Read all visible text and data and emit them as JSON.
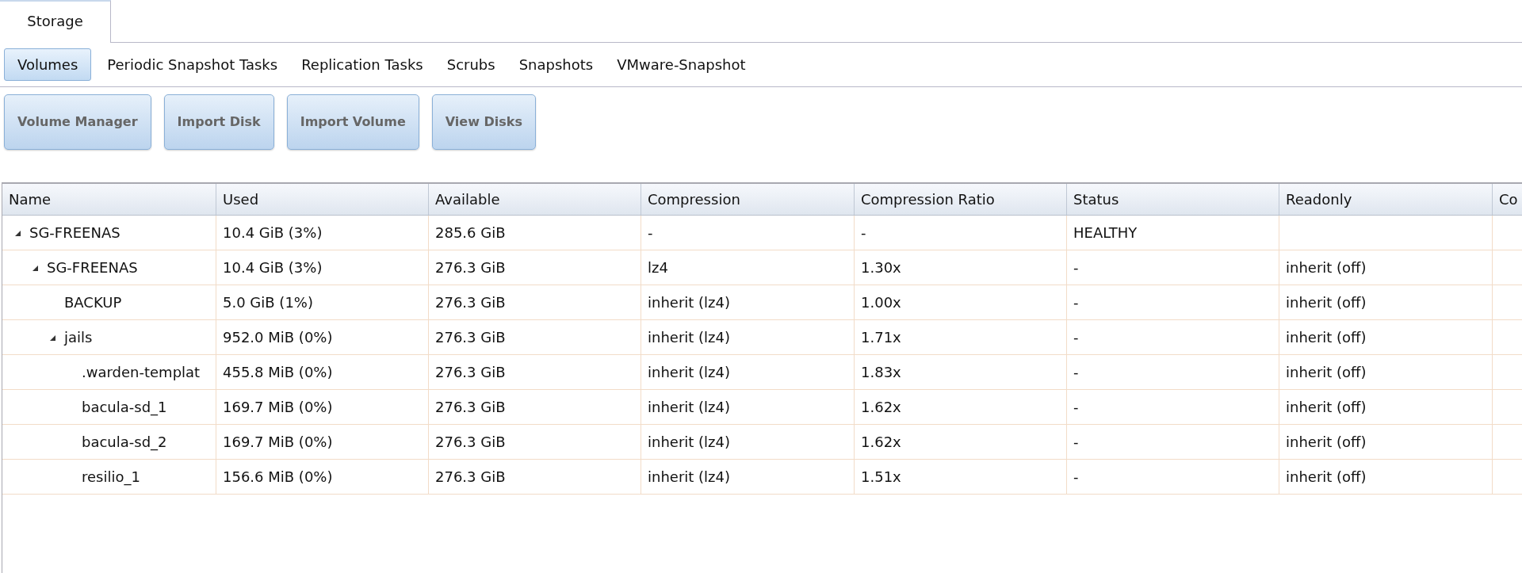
{
  "tabs": [
    {
      "label": "Storage",
      "selected": true
    }
  ],
  "subtabs": [
    {
      "label": "Volumes",
      "selected": true
    },
    {
      "label": "Periodic Snapshot Tasks",
      "selected": false
    },
    {
      "label": "Replication Tasks",
      "selected": false
    },
    {
      "label": "Scrubs",
      "selected": false
    },
    {
      "label": "Snapshots",
      "selected": false
    },
    {
      "label": "VMware-Snapshot",
      "selected": false
    }
  ],
  "buttons": [
    "Volume Manager",
    "Import Disk",
    "Import Volume",
    "View Disks"
  ],
  "table": {
    "columns": [
      "Name",
      "Used",
      "Available",
      "Compression",
      "Compression Ratio",
      "Status",
      "Readonly",
      "Co"
    ],
    "rows": [
      {
        "name": "SG-FREENAS",
        "used": "10.4 GiB (3%)",
        "available": "285.6 GiB",
        "compression": "-",
        "ratio": "-",
        "status": "HEALTHY",
        "expanded": true,
        "children": [
          {
            "name": "SG-FREENAS",
            "used": "10.4 GiB (3%)",
            "available": "276.3 GiB",
            "compression": "lz4",
            "ratio": "1.30x",
            "status": "-",
            "readonly": "inherit (off)",
            "expanded": true,
            "children": [
              {
                "name": "BACKUP",
                "used": "5.0 GiB (1%)",
                "available": "276.3 GiB",
                "compression": "inherit (lz4)",
                "ratio": "1.00x",
                "status": "-",
                "readonly": "inherit (off)"
              },
              {
                "name": "jails",
                "used": "952.0 MiB (0%)",
                "available": "276.3 GiB",
                "compression": "inherit (lz4)",
                "ratio": "1.71x",
                "status": "-",
                "readonly": "inherit (off)",
                "expanded": true,
                "children": [
                  {
                    "name": ".warden-templat",
                    "used": "455.8 MiB (0%)",
                    "available": "276.3 GiB",
                    "compression": "inherit (lz4)",
                    "ratio": "1.83x",
                    "status": "-",
                    "readonly": "inherit (off)"
                  },
                  {
                    "name": "bacula-sd_1",
                    "used": "169.7 MiB (0%)",
                    "available": "276.3 GiB",
                    "compression": "inherit (lz4)",
                    "ratio": "1.62x",
                    "status": "-",
                    "readonly": "inherit (off)"
                  },
                  {
                    "name": "bacula-sd_2",
                    "used": "169.7 MiB (0%)",
                    "available": "276.3 GiB",
                    "compression": "inherit (lz4)",
                    "ratio": "1.62x",
                    "status": "-",
                    "readonly": "inherit (off)"
                  },
                  {
                    "name": "resilio_1",
                    "used": "156.6 MiB (0%)",
                    "available": "276.3 GiB",
                    "compression": "inherit (lz4)",
                    "ratio": "1.51x",
                    "status": "-",
                    "readonly": "inherit (off)"
                  }
                ]
              }
            ]
          }
        ]
      }
    ]
  }
}
